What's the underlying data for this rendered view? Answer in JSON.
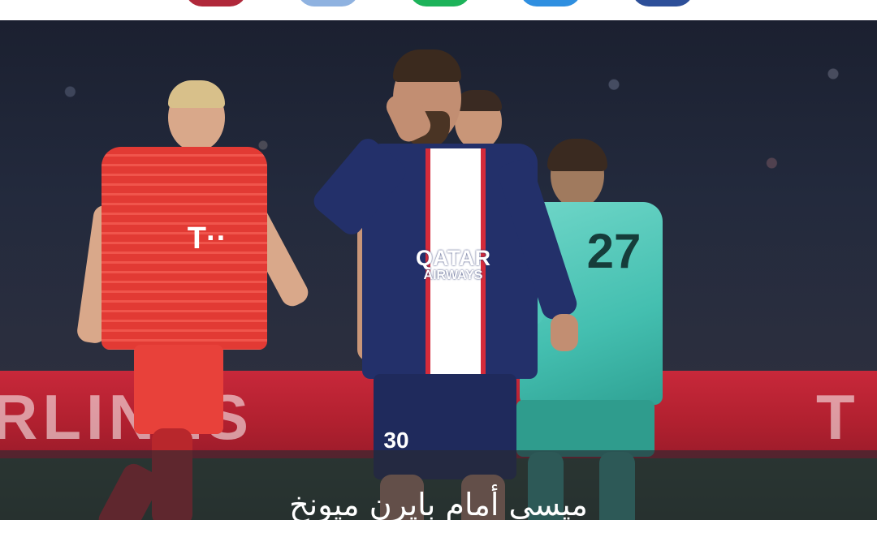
{
  "share_bar": {
    "buttons": [
      {
        "name": "share-button-1",
        "color": "#b0283a"
      },
      {
        "name": "share-button-2",
        "color": "#8fb2e0"
      },
      {
        "name": "share-button-3",
        "color": "#1db35a"
      },
      {
        "name": "share-button-4",
        "color": "#2f8fe0"
      },
      {
        "name": "share-button-5",
        "color": "#2d4f99"
      }
    ]
  },
  "photo": {
    "board_text_left": "RLINES",
    "board_text_right": "T",
    "messi_sponsor_line1": "QATAR",
    "messi_sponsor_line2": "AIRWAYS",
    "messi_number": "30",
    "keeper_number": "27",
    "bayern_sponsor": "T··"
  },
  "caption": {
    "text": "ميسي أمام بايرن ميونخ"
  }
}
